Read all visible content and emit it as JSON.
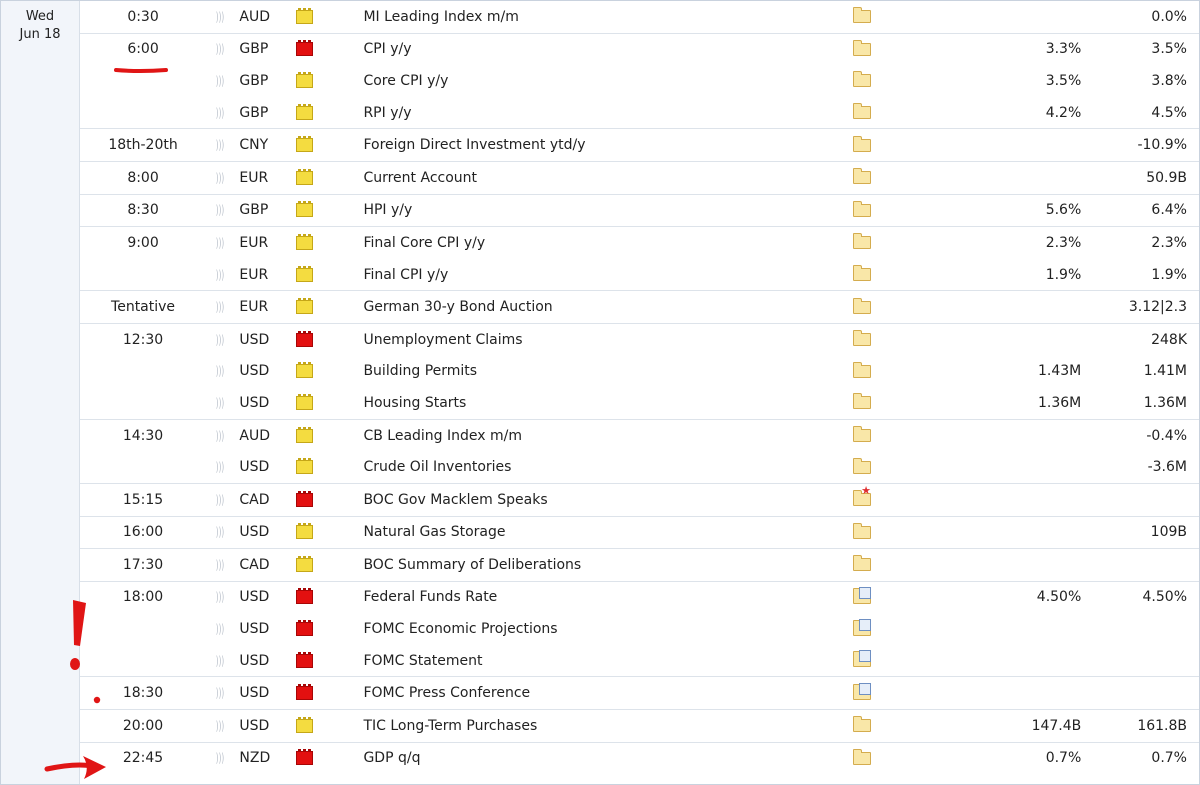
{
  "date": {
    "dow": "Wed",
    "day": "Jun 18"
  },
  "colors": {
    "low_impact": "#f4dc40",
    "high_impact": "#e31010",
    "annotation": "#e01515"
  },
  "icons": {
    "sound": "sound-icon",
    "folder": "folder-icon",
    "folder_doc": "folder-document-icon",
    "folder_star": "folder-star-icon"
  },
  "rows": [
    {
      "time": "0:30",
      "currency": "AUD",
      "impact": "low",
      "event": "MI Leading Index m/m",
      "detail": "folder",
      "forecast": "",
      "previous": "0.0%",
      "sep": true
    },
    {
      "time": "6:00",
      "currency": "GBP",
      "impact": "high",
      "event": "CPI y/y",
      "detail": "folder",
      "forecast": "3.3%",
      "previous": "3.5%",
      "sep": true
    },
    {
      "time": "",
      "currency": "GBP",
      "impact": "low",
      "event": "Core CPI y/y",
      "detail": "folder",
      "forecast": "3.5%",
      "previous": "3.8%",
      "sep": false
    },
    {
      "time": "",
      "currency": "GBP",
      "impact": "low",
      "event": "RPI y/y",
      "detail": "folder",
      "forecast": "4.2%",
      "previous": "4.5%",
      "sep": false
    },
    {
      "time": "18th-20th",
      "currency": "CNY",
      "impact": "low",
      "event": "Foreign Direct Investment ytd/y",
      "detail": "folder",
      "forecast": "",
      "previous": "-10.9%",
      "sep": true
    },
    {
      "time": "8:00",
      "currency": "EUR",
      "impact": "low",
      "event": "Current Account",
      "detail": "folder",
      "forecast": "",
      "previous": "50.9B",
      "sep": true
    },
    {
      "time": "8:30",
      "currency": "GBP",
      "impact": "low",
      "event": "HPI y/y",
      "detail": "folder",
      "forecast": "5.6%",
      "previous": "6.4%",
      "sep": true
    },
    {
      "time": "9:00",
      "currency": "EUR",
      "impact": "low",
      "event": "Final Core CPI y/y",
      "detail": "folder",
      "forecast": "2.3%",
      "previous": "2.3%",
      "sep": true
    },
    {
      "time": "",
      "currency": "EUR",
      "impact": "low",
      "event": "Final CPI y/y",
      "detail": "folder",
      "forecast": "1.9%",
      "previous": "1.9%",
      "sep": false
    },
    {
      "time": "Tentative",
      "currency": "EUR",
      "impact": "low",
      "event": "German 30-y Bond Auction",
      "detail": "folder",
      "forecast": "",
      "previous": "3.12|2.3",
      "sep": true
    },
    {
      "time": "12:30",
      "currency": "USD",
      "impact": "high",
      "event": "Unemployment Claims",
      "detail": "folder",
      "forecast": "",
      "previous": "248K",
      "sep": true
    },
    {
      "time": "",
      "currency": "USD",
      "impact": "low",
      "event": "Building Permits",
      "detail": "folder",
      "forecast": "1.43M",
      "previous": "1.41M",
      "sep": false
    },
    {
      "time": "",
      "currency": "USD",
      "impact": "low",
      "event": "Housing Starts",
      "detail": "folder",
      "forecast": "1.36M",
      "previous": "1.36M",
      "sep": false
    },
    {
      "time": "14:30",
      "currency": "AUD",
      "impact": "low",
      "event": "CB Leading Index m/m",
      "detail": "folder",
      "forecast": "",
      "previous": "-0.4%",
      "sep": true
    },
    {
      "time": "",
      "currency": "USD",
      "impact": "low",
      "event": "Crude Oil Inventories",
      "detail": "folder",
      "forecast": "",
      "previous": "-3.6M",
      "sep": false
    },
    {
      "time": "15:15",
      "currency": "CAD",
      "impact": "high",
      "event": "BOC Gov Macklem Speaks",
      "detail": "star",
      "forecast": "",
      "previous": "",
      "sep": true
    },
    {
      "time": "16:00",
      "currency": "USD",
      "impact": "low",
      "event": "Natural Gas Storage",
      "detail": "folder",
      "forecast": "",
      "previous": "109B",
      "sep": true
    },
    {
      "time": "17:30",
      "currency": "CAD",
      "impact": "low",
      "event": "BOC Summary of Deliberations",
      "detail": "folder",
      "forecast": "",
      "previous": "",
      "sep": true
    },
    {
      "time": "18:00",
      "currency": "USD",
      "impact": "high",
      "event": "Federal Funds Rate",
      "detail": "doc",
      "forecast": "4.50%",
      "previous": "4.50%",
      "sep": true
    },
    {
      "time": "",
      "currency": "USD",
      "impact": "high",
      "event": "FOMC Economic Projections",
      "detail": "doc",
      "forecast": "",
      "previous": "",
      "sep": false
    },
    {
      "time": "",
      "currency": "USD",
      "impact": "high",
      "event": "FOMC Statement",
      "detail": "doc",
      "forecast": "",
      "previous": "",
      "sep": false
    },
    {
      "time": "18:30",
      "currency": "USD",
      "impact": "high",
      "event": "FOMC Press Conference",
      "detail": "doc",
      "forecast": "",
      "previous": "",
      "sep": true,
      "dot_left": true
    },
    {
      "time": "20:00",
      "currency": "USD",
      "impact": "low",
      "event": "TIC Long-Term Purchases",
      "detail": "folder",
      "forecast": "147.4B",
      "previous": "161.8B",
      "sep": true
    },
    {
      "time": "22:45",
      "currency": "NZD",
      "impact": "high",
      "event": "GDP q/q",
      "detail": "folder",
      "forecast": "0.7%",
      "previous": "0.7%",
      "sep": true,
      "dot_currency": true
    }
  ]
}
